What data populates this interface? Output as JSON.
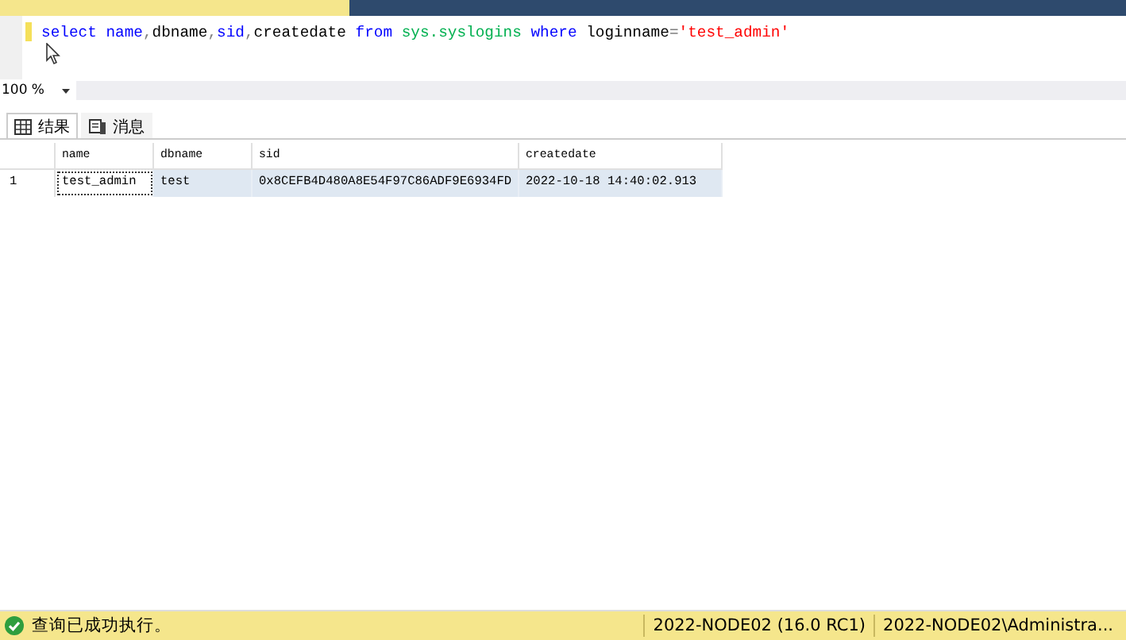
{
  "document_tabs": [
    {
      "selected": true
    },
    {
      "selected": false
    }
  ],
  "editor": {
    "query": [
      {
        "text": "select ",
        "kind": "keyword"
      },
      {
        "text": "name",
        "kind": "keyword"
      },
      {
        "text": ",",
        "kind": "operator"
      },
      {
        "text": "dbname",
        "kind": "plain"
      },
      {
        "text": ",",
        "kind": "operator"
      },
      {
        "text": "sid",
        "kind": "keyword"
      },
      {
        "text": ",",
        "kind": "operator"
      },
      {
        "text": "createdate ",
        "kind": "plain"
      },
      {
        "text": "from ",
        "kind": "keyword"
      },
      {
        "text": "sys.syslogins ",
        "kind": "system"
      },
      {
        "text": "where ",
        "kind": "keyword"
      },
      {
        "text": "loginname",
        "kind": "plain"
      },
      {
        "text": "=",
        "kind": "operator"
      },
      {
        "text": "'test_admin'",
        "kind": "string"
      }
    ]
  },
  "zoom": {
    "value": "100 %"
  },
  "result_tabs": [
    {
      "label": "结果",
      "kind": "grid",
      "selected": true
    },
    {
      "label": "消息",
      "kind": "messages",
      "selected": false
    }
  ],
  "table": {
    "columns": [
      "name",
      "dbname",
      "sid",
      "createdate"
    ],
    "rows": [
      {
        "number": "1",
        "cells": [
          "test_admin",
          "test",
          "0x8CEFB4D480A8E54F97C86ADF9E6934FD",
          "2022-10-18 14:40:02.913"
        ]
      }
    ]
  },
  "status_bar": {
    "message": "查询已成功执行。",
    "server": "2022-NODE02 (16.0 RC1)",
    "user": "2022-NODE02\\Administra..."
  }
}
